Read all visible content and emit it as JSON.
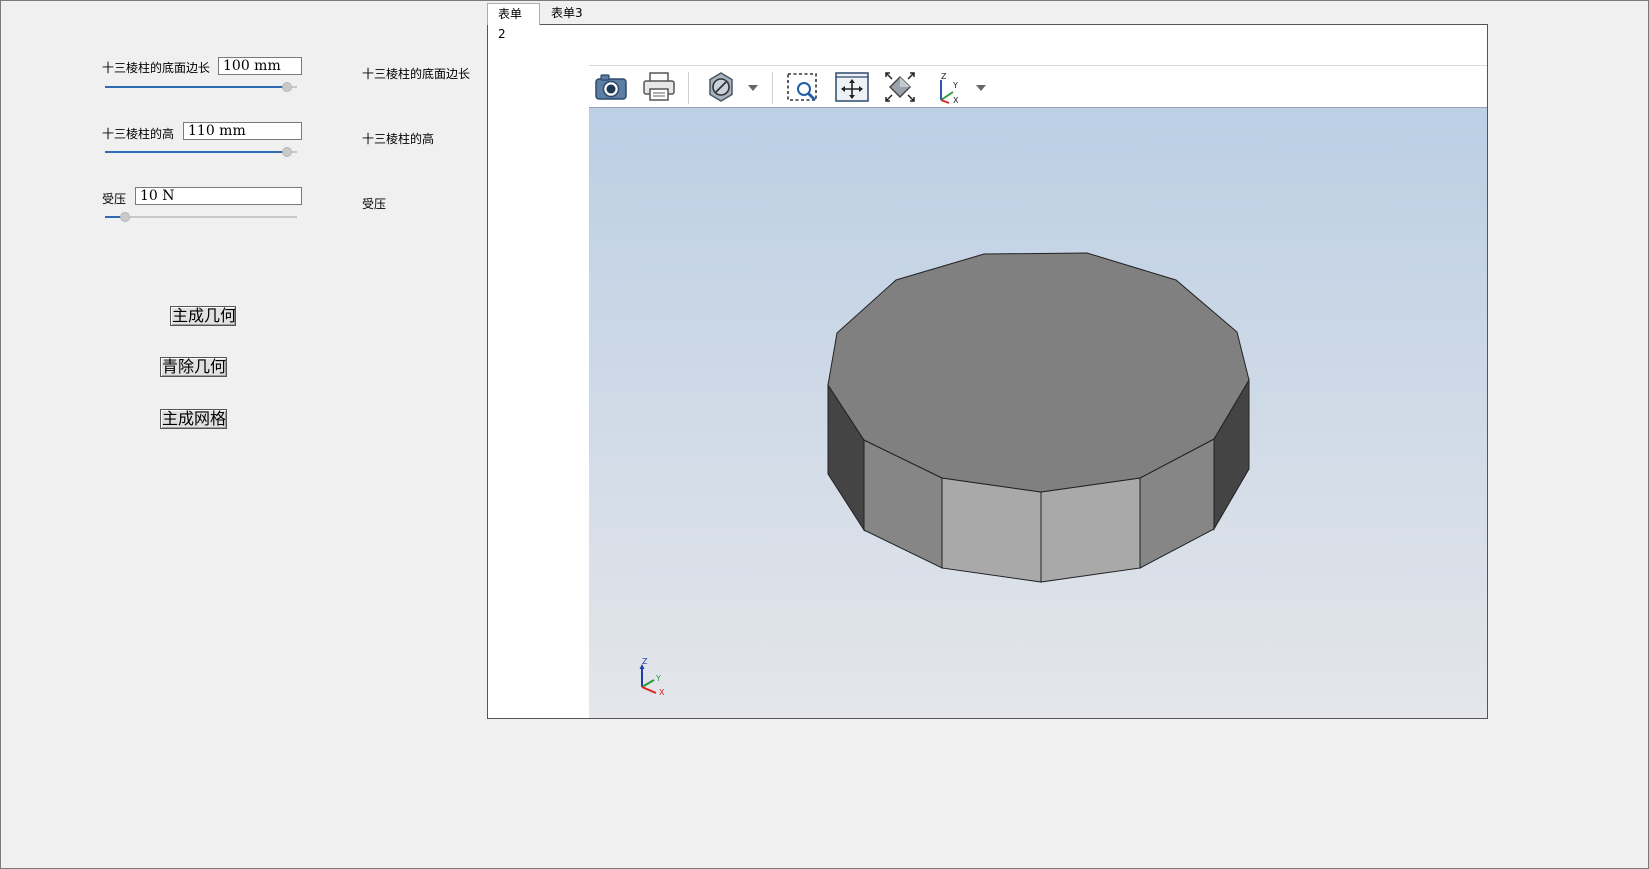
{
  "params": [
    {
      "label": "十三棱柱的底面边长",
      "value": "100  mm",
      "side_label": "十三棱柱的底面边长",
      "slider_fraction": 0.97
    },
    {
      "label": "十三棱柱的高",
      "value": "110  mm",
      "side_label": "十三棱柱的高",
      "slider_fraction": 0.97
    },
    {
      "label": "受压",
      "value": "10  N",
      "side_label": "受压",
      "slider_fraction": 0.08
    }
  ],
  "buttons": {
    "generate_geometry": "主成几何",
    "clear_geometry": "青除几何",
    "generate_mesh": "主成网格"
  },
  "tabs": [
    "表单2",
    "表单3"
  ],
  "active_tab": "表单2",
  "toolbar": {
    "items": [
      "camera-icon",
      "print-icon",
      "render-style-icon",
      "zoom-window-icon",
      "pan-icon",
      "fit-all-icon",
      "view-orientation-icon"
    ]
  },
  "triad": {
    "z": "Z",
    "y": "Y",
    "x": "X"
  },
  "colors": {
    "slider_fill": "#2e6bb3",
    "viewer_top": "#b9cde4",
    "viewer_bottom": "#e4e6ea",
    "prism_top": "#808080",
    "prism_front": "#a9a9a9",
    "prism_side": "#868686",
    "prism_dark": "#444444"
  }
}
